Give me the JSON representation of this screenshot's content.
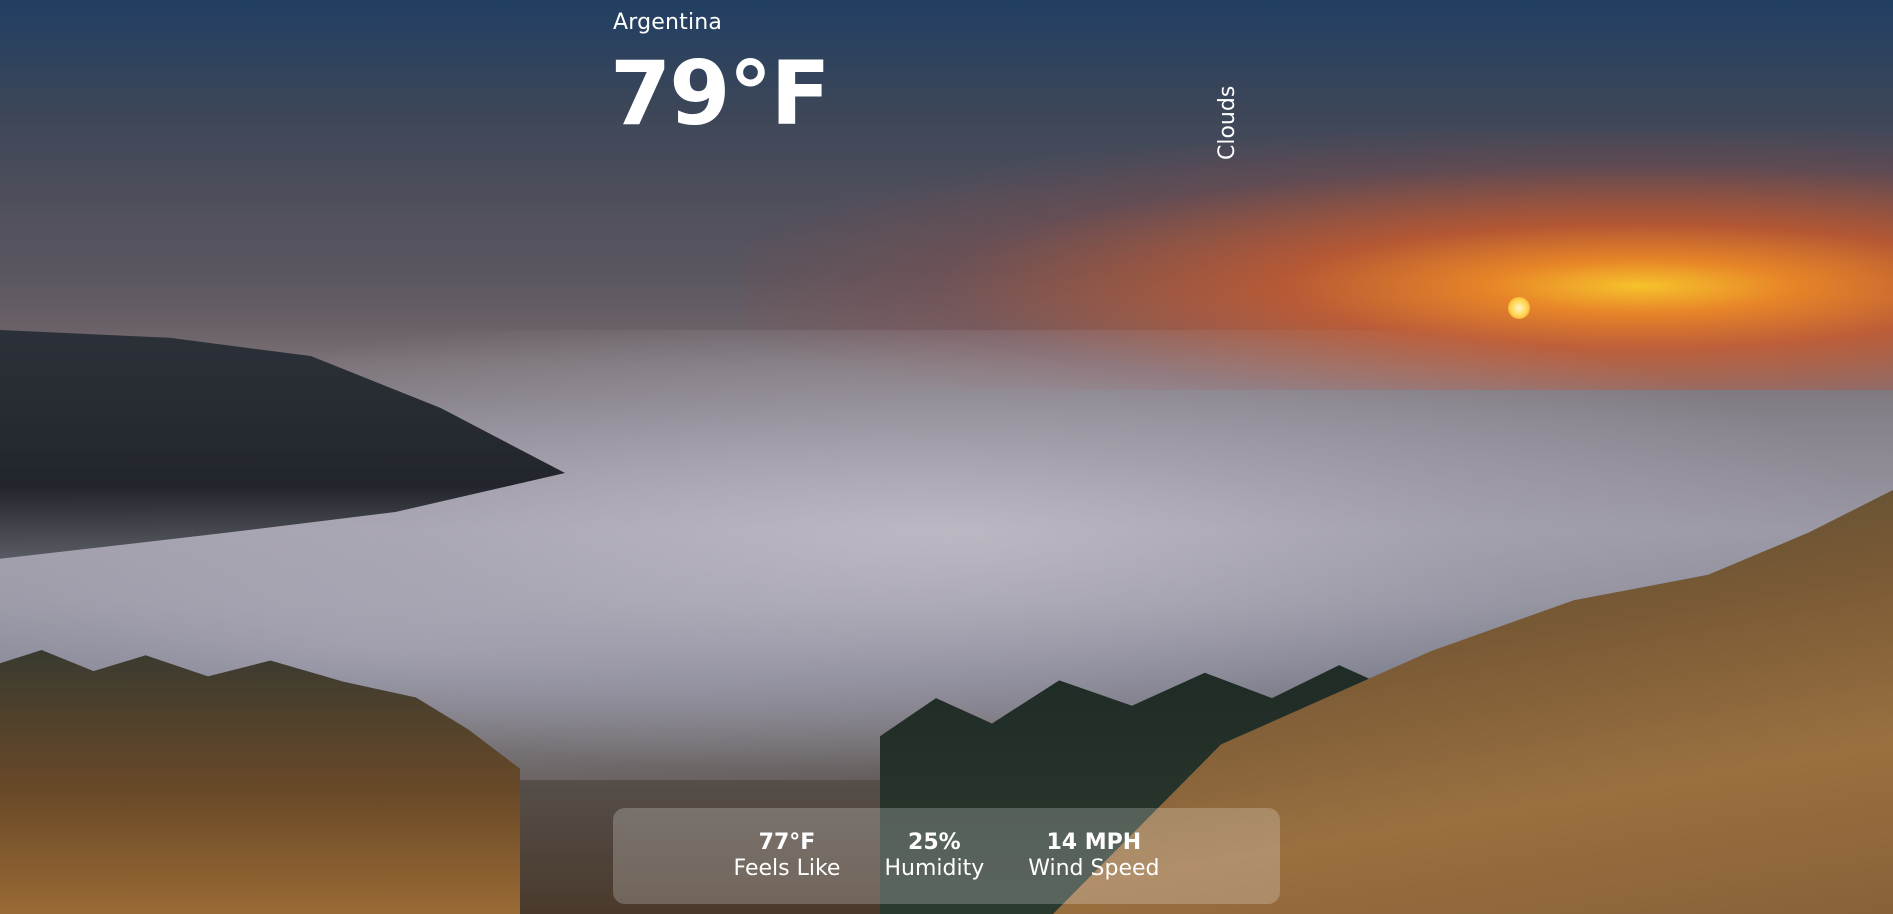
{
  "weather": {
    "location": "Argentina",
    "temperature": "79°F",
    "condition": "Clouds"
  },
  "stats": [
    {
      "value": "77°F",
      "label": "Feels Like"
    },
    {
      "value": "25%",
      "label": "Humidity"
    },
    {
      "value": "14 MPH",
      "label": "Wind Speed"
    }
  ],
  "colors": {
    "text": "#ffffff",
    "panel_background": "rgba(255,255,255,0.22)"
  }
}
